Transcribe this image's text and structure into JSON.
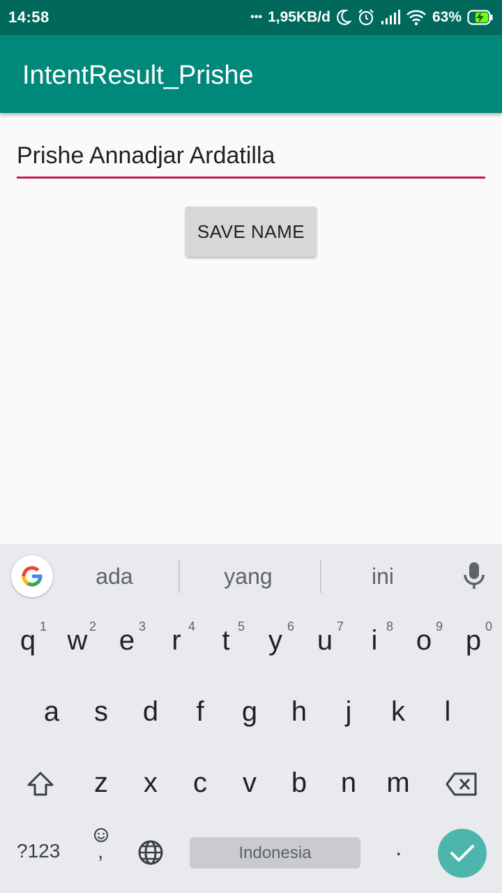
{
  "status_bar": {
    "time": "14:58",
    "dots": "•••",
    "network_speed": "1,95KB/d",
    "battery_percent": "63%"
  },
  "app_bar": {
    "title": "IntentResult_Prishe"
  },
  "form": {
    "name_value": "Prishe Annadjar Ardatilla",
    "save_label": "SAVE NAME"
  },
  "keyboard": {
    "suggestions": [
      "ada",
      "yang",
      "ini"
    ],
    "row1": [
      {
        "ch": "q",
        "hint": "1"
      },
      {
        "ch": "w",
        "hint": "2"
      },
      {
        "ch": "e",
        "hint": "3"
      },
      {
        "ch": "r",
        "hint": "4"
      },
      {
        "ch": "t",
        "hint": "5"
      },
      {
        "ch": "y",
        "hint": "6"
      },
      {
        "ch": "u",
        "hint": "7"
      },
      {
        "ch": "i",
        "hint": "8"
      },
      {
        "ch": "o",
        "hint": "9"
      },
      {
        "ch": "p",
        "hint": "0"
      }
    ],
    "row2": [
      "a",
      "s",
      "d",
      "f",
      "g",
      "h",
      "j",
      "k",
      "l"
    ],
    "row3": [
      "z",
      "x",
      "c",
      "v",
      "b",
      "n",
      "m"
    ],
    "symbols_label": "?123",
    "emoji_comma_label": ",",
    "space_label": "Indonesia",
    "period_label": ".",
    "accent_color": "#4db6ac",
    "icons": [
      "google-g-icon",
      "mic-icon",
      "shift-icon",
      "backspace-icon",
      "emoji-icon",
      "globe-icon",
      "checkmark-icon"
    ]
  },
  "colors": {
    "status_bar": "#00695c",
    "app_bar": "#00897b",
    "field_underline": "#c2185b",
    "button_bg": "#d6d7d7"
  }
}
